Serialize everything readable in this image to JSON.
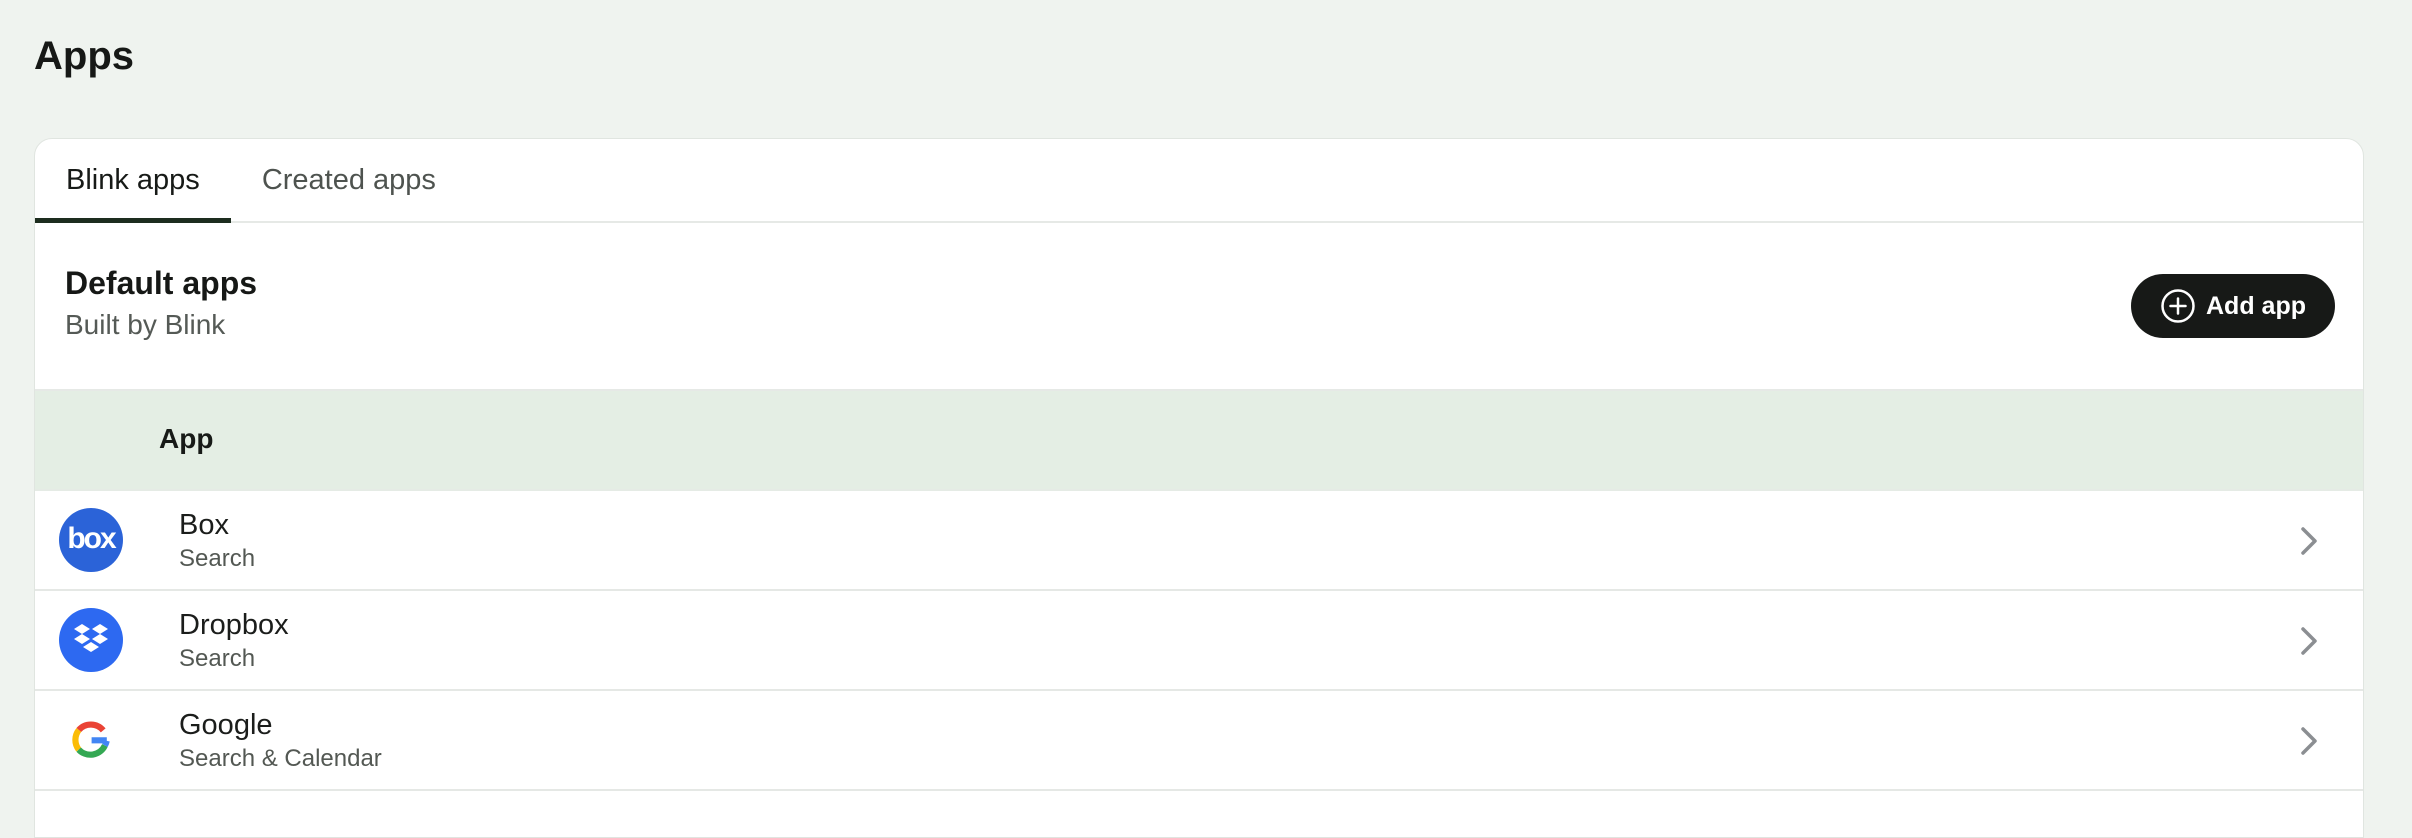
{
  "page": {
    "title": "Apps"
  },
  "tabs": [
    {
      "label": "Blink apps",
      "active": true
    },
    {
      "label": "Created apps",
      "active": false
    }
  ],
  "section": {
    "title": "Default apps",
    "subtitle": "Built by Blink"
  },
  "actions": {
    "add_app_label": "Add app",
    "add_app_icon": "plus-circle-icon"
  },
  "table": {
    "header": "App",
    "rows": [
      {
        "name": "Box",
        "description": "Search",
        "logo_text": "box",
        "icon": "box-logo-icon",
        "color": "#2b63d8"
      },
      {
        "name": "Dropbox",
        "description": "Search",
        "icon": "dropbox-logo-icon",
        "color": "#2d69f1"
      },
      {
        "name": "Google",
        "description": "Search & Calendar",
        "icon": "google-logo-icon",
        "color": "#ffffff"
      }
    ]
  },
  "colors": {
    "background": "#eff3ef",
    "card": "#ffffff",
    "tab_indicator": "#1d2d1f",
    "table_header": "#e4eee4",
    "button": "#171917",
    "chevron": "#8b8e92"
  }
}
